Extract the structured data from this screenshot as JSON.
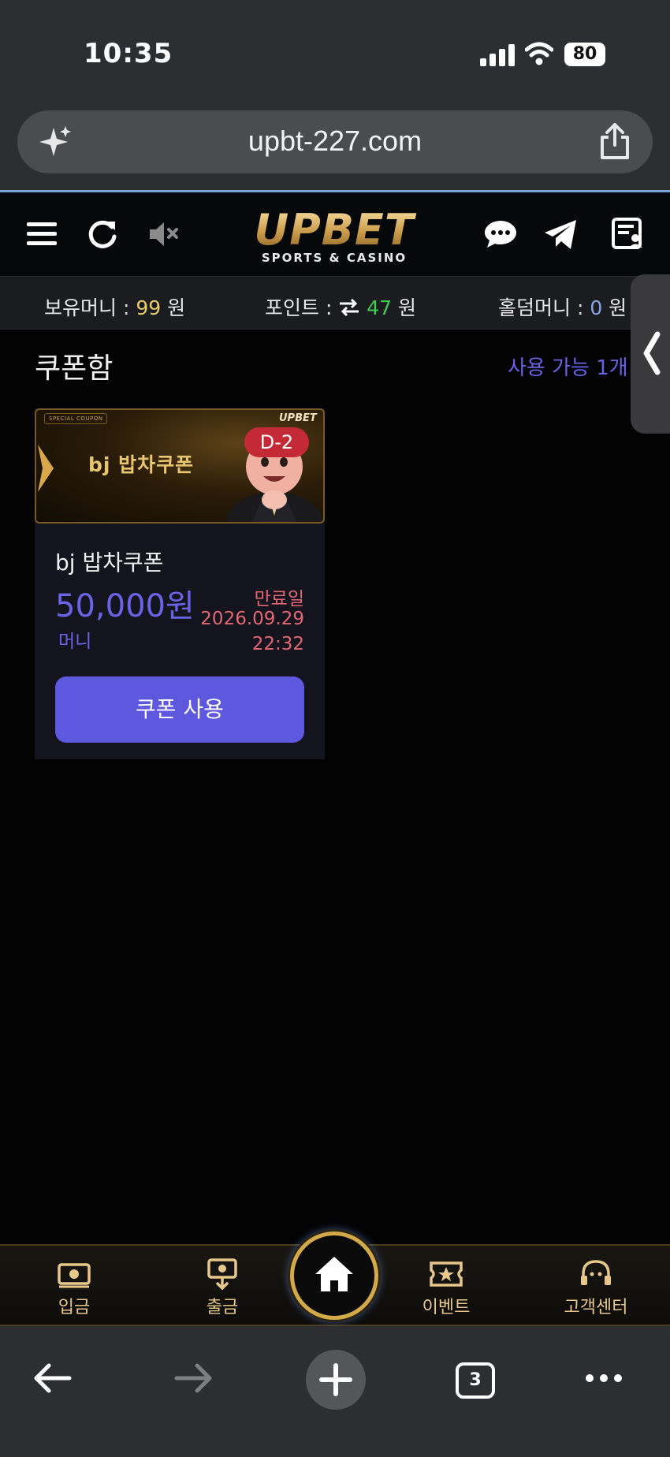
{
  "status_bar": {
    "time": "10:35",
    "battery": "80"
  },
  "browser": {
    "url": "upbt-227.com",
    "tab_count": "3"
  },
  "header": {
    "logo_main": "UPBET",
    "logo_sub": "SPORTS & CASINO"
  },
  "balance": {
    "money_label": "보유머니 : ",
    "money_value": "99",
    "money_unit": " 원",
    "point_label": "포인트 : ",
    "point_value": "47",
    "point_unit": " 원",
    "holdem_label": "홀덤머니 : ",
    "holdem_value": "0",
    "holdem_unit": " 원"
  },
  "coupon_box": {
    "title": "쿠폰함",
    "available": "사용 가능 1개",
    "coupons": [
      {
        "banner_badge": "SPECIAL COUPON",
        "banner_brand": "UPBET",
        "banner_text": "bj 밥차쿠폰",
        "dday": "D-2",
        "name": "bj 밥차쿠폰",
        "amount": "50,000원",
        "type": "머니",
        "expiry_label": "만료일",
        "expiry_date": "2026.09.29",
        "expiry_time": "22:32",
        "use_label": "쿠폰 사용"
      }
    ]
  },
  "bottom_nav": {
    "deposit": "입금",
    "withdraw": "출금",
    "event": "이벤트",
    "support": "고객센터"
  },
  "colors": {
    "accent": "#5e58df",
    "gold": "#d4a94a",
    "expiry": "#e26673",
    "points": "#3fce52"
  }
}
